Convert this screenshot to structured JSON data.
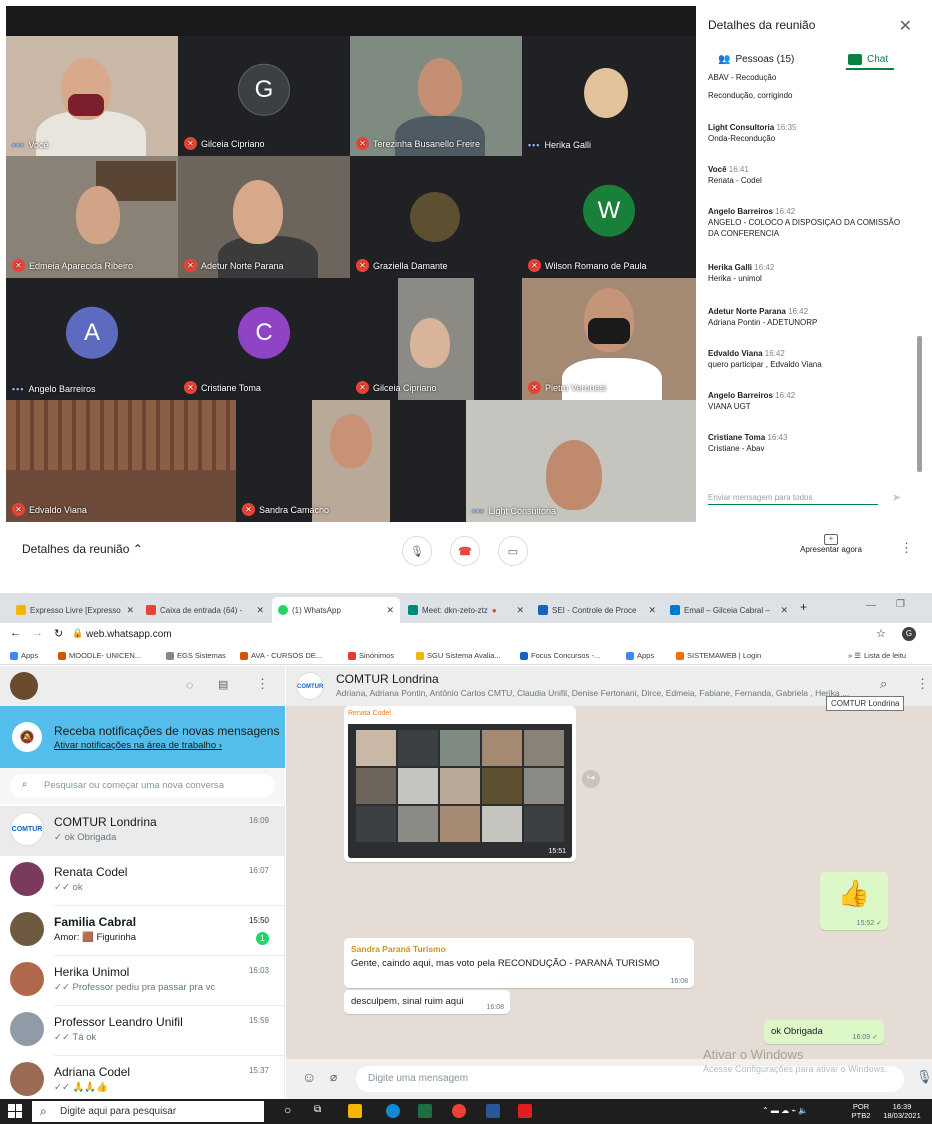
{
  "meet": {
    "panel_title": "Detalhes da reunião",
    "tab_people": "Pessoas (15)",
    "tab_chat": "Chat",
    "chat": [
      {
        "sender": "",
        "time": "",
        "text": "ABAV - Recodução"
      },
      {
        "sender": "",
        "time": "",
        "text": "Recondução, corrigindo"
      },
      {
        "sender": "Light Consultoria",
        "time": "16:35",
        "text": "Onda-Recondução"
      },
      {
        "sender": "Você",
        "time": "16:41",
        "text": "Renata - Codel"
      },
      {
        "sender": "Angelo Barreiros",
        "time": "16:42",
        "text": "ANGELO - COLOCO A DISPOSIÇAO DA COMISSÃO DA CONFERENCIA"
      },
      {
        "sender": "Herika Galli",
        "time": "16:42",
        "text": "Herika - unimol"
      },
      {
        "sender": "Adetur Norte Parana",
        "time": "16:42",
        "text": "Adriana Pontin - ADETUNORP"
      },
      {
        "sender": "Edvaldo Viana",
        "time": "16:42",
        "text": "quero participar , Edvaldo Viana"
      },
      {
        "sender": "Angelo Barreiros",
        "time": "16:42",
        "text": "VIANA UGT"
      },
      {
        "sender": "Cristiane Toma",
        "time": "16:43",
        "text": "Cristiane - Abav"
      }
    ],
    "send_placeholder": "Enviar mensagem para todos",
    "bottom_details": "Detalhes da reunião",
    "present_label": "Apresentar agora",
    "participants": [
      {
        "name": "Você",
        "indicator": "dots"
      },
      {
        "name": "Gilceia Cipriano",
        "indicator": "mic",
        "avatar": "G",
        "color": "#3c4043"
      },
      {
        "name": "Terezinha Busanello Freire",
        "indicator": "mic"
      },
      {
        "name": "Herika Galli",
        "indicator": "dots"
      },
      {
        "name": "Edmeia Aparecida Ribeiro",
        "indicator": "mic"
      },
      {
        "name": "Adetur Norte Parana",
        "indicator": "mic"
      },
      {
        "name": "Graziella Damante",
        "indicator": "mic"
      },
      {
        "name": "Wilson Romano de Paula",
        "indicator": "mic",
        "avatar": "W",
        "color": "#188038"
      },
      {
        "name": "Angelo Barreiros",
        "indicator": "dots",
        "avatar": "A",
        "color": "#5c6bc0"
      },
      {
        "name": "Cristiane Toma",
        "indicator": "mic",
        "avatar": "C",
        "color": "#8e44c4"
      },
      {
        "name": "Gilceia Cipriano",
        "indicator": "mic"
      },
      {
        "name": "Pietro Veronesi",
        "indicator": "mic"
      },
      {
        "name": "Edvaldo Viana",
        "indicator": "mic"
      },
      {
        "name": "Sandra Camacho",
        "indicator": "mic"
      },
      {
        "name": "Light Consultoria",
        "indicator": "dots"
      }
    ]
  },
  "browser": {
    "tabs": [
      {
        "label": "Expresso Livre [Expresso",
        "color": "#f4b400"
      },
      {
        "label": "Caixa de entrada (64) -",
        "color": "#ea4335"
      },
      {
        "label": "(1) WhatsApp",
        "color": "#25d366"
      },
      {
        "label": "Meet: dkn-zeto-ztz",
        "color": "#00897b"
      },
      {
        "label": "SEI - Controle de Proce",
        "color": "#1565c0"
      },
      {
        "label": "Email – Gilceia Cabral –",
        "color": "#0078d4"
      }
    ],
    "url": "web.whatsapp.com",
    "bookmarks": [
      "Apps",
      "MOODLE- UNICEN...",
      "EGS Sistemas",
      "AVA - CURSOS DE...",
      "Sinónimos",
      "SGU Sistema Avalia...",
      "Focus Concursos -...",
      "Apps",
      "SISTEMAWEB | Login"
    ],
    "reading_list": "Lista de leitu"
  },
  "whatsapp": {
    "notif_title": "Receba notificações de novas mensagens",
    "notif_link": "Ativar notificações na área de trabalho ›",
    "search_placeholder": "Pesquisar ou começar uma nova conversa",
    "conversations": [
      {
        "name": "COMTUR Londrina",
        "last": "✓ ok Obrigada",
        "time": "16:09"
      },
      {
        "name": "Renata Codel",
        "last": "✓✓ ok",
        "time": "16:07"
      },
      {
        "name": "Familia Cabral",
        "last": "Amor: 🟫 Figurinha",
        "time": "15:50",
        "badge": "1"
      },
      {
        "name": "Herika Unimol",
        "last": "✓✓ Professor pediu pra passar pra vc",
        "time": "16:03"
      },
      {
        "name": "Professor Leandro Unifil",
        "last": "✓✓ Tá ok",
        "time": "15:59"
      },
      {
        "name": "Adriana Codel",
        "last": "✓✓ 🙏🙏👍",
        "time": "15:37"
      }
    ],
    "chat_name": "COMTUR Londrina",
    "chat_members": "Adriana, Adriana Pontin, Antônio Carlos CMTU, Claudia Unifil, Denise Fertonani, Dirce, Edmeia, Fabiane, Fernanda, Gabriela , Herika ...",
    "tooltip": "COMTUR Londrina",
    "img_sender": "Renata Codel",
    "img_time": "15:51",
    "thumb_time": "15:52 ✓",
    "msg1_sender": "Sandra Paraná Turismo",
    "msg1_text": "Gente, caindo aqui, mas voto pela RECONDUÇÃO - PARANÁ TURISMO",
    "msg1_time": "16:08",
    "msg2_text": "desculpem, sinal ruim aqui",
    "msg2_time": "16:08",
    "msg3_text": "ok Obrigada",
    "msg3_time": "16:09 ✓",
    "compose_placeholder": "Digite uma mensagem",
    "activate_title": "Ativar o Windows",
    "activate_sub": "Acesse Configurações para ativar o Windows."
  },
  "taskbar": {
    "search": "Digite aqui para pesquisar",
    "lang1": "POR",
    "lang2": "PTB2",
    "time": "16:39",
    "date": "18/03/2021"
  }
}
